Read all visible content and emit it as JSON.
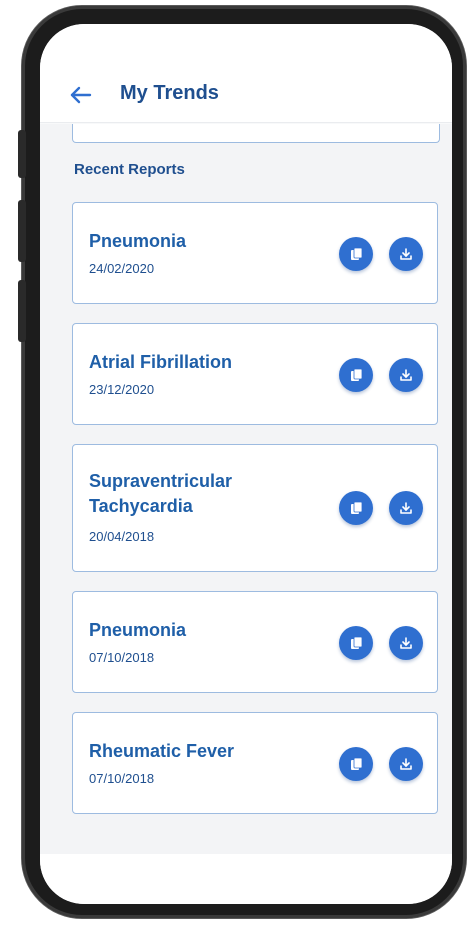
{
  "header": {
    "title": "My Trends"
  },
  "section": {
    "title": "Recent Reports"
  },
  "reports": [
    {
      "name": "Pneumonia",
      "date": "24/02/2020"
    },
    {
      "name": "Atrial Fibrillation",
      "date": "23/12/2020"
    },
    {
      "name": "Supraventricular Tachycardia",
      "date": "20/04/2018"
    },
    {
      "name": "Pneumonia",
      "date": "07/10/2018"
    },
    {
      "name": "Rheumatic Fever",
      "date": "07/10/2018"
    }
  ],
  "icons": {
    "back": "arrow-left-icon",
    "view": "document-icon",
    "download": "download-icon"
  },
  "colors": {
    "primary": "#1f4f8f",
    "accent": "#2f6fd0",
    "card_border": "#9dbbe0",
    "background": "#f3f4f6"
  }
}
